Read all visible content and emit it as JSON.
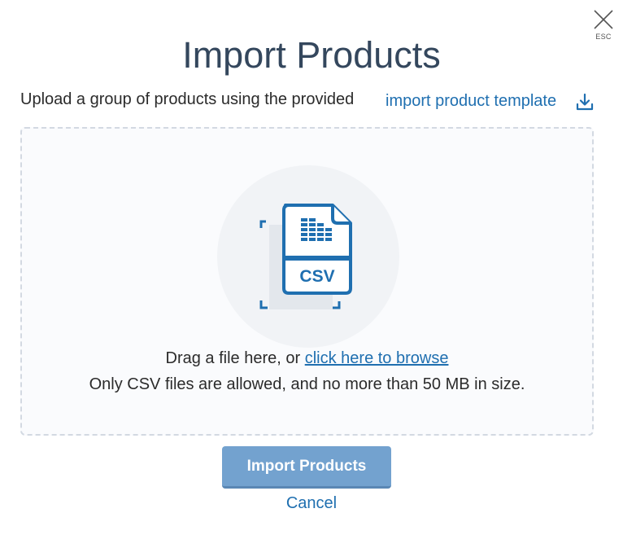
{
  "dialog": {
    "title": "Import Products",
    "close_hint": "ESC",
    "intro_text": "Upload a group of products using the provided",
    "template_link": "import product template"
  },
  "dropzone": {
    "file_label": "CSV",
    "drag_text": "Drag a file here, or ",
    "browse_link": "click here to browse",
    "size_note": "Only CSV files are allowed, and no more than 50 MB in size."
  },
  "actions": {
    "import_label": "Import Products",
    "cancel_label": "Cancel"
  },
  "colors": {
    "accent": "#1f6fb0",
    "title": "#34475d",
    "button_disabled": "#73a2cf"
  },
  "icons": {
    "close": "close-icon",
    "download": "download-icon",
    "file": "csv-file-icon"
  }
}
